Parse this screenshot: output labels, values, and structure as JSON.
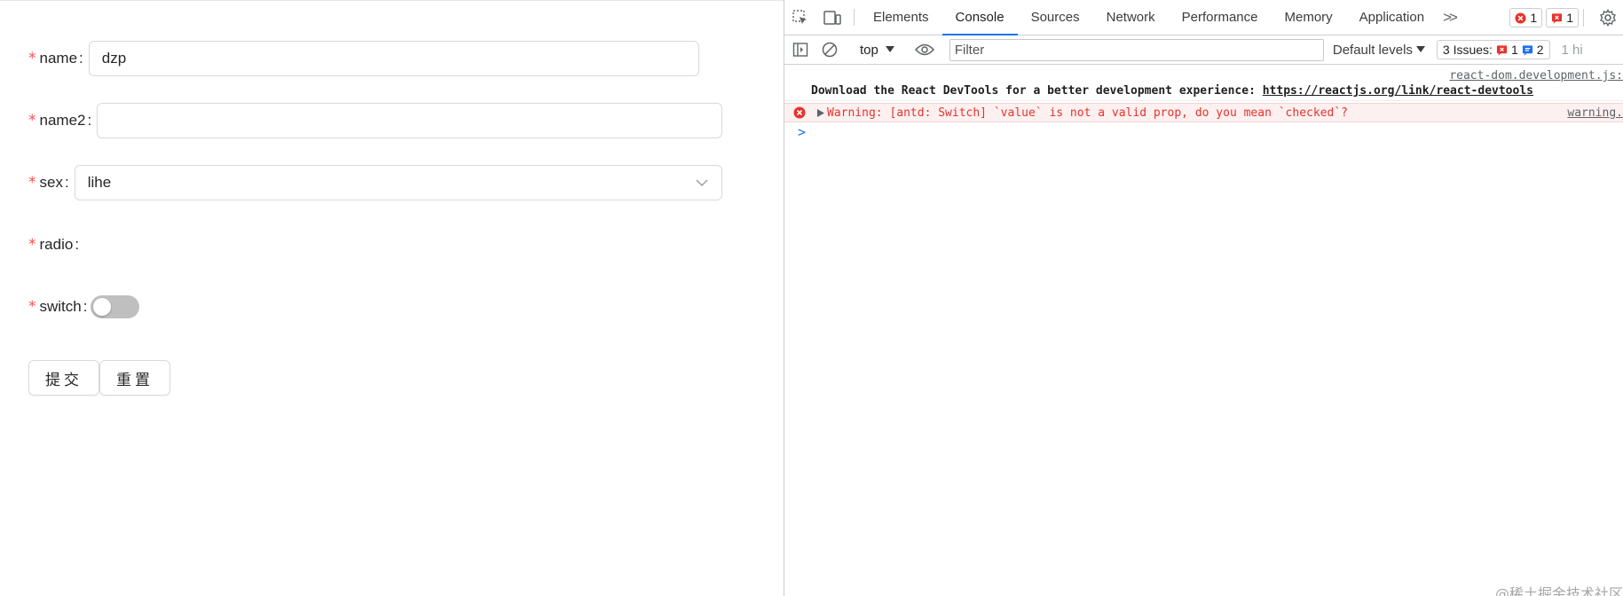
{
  "form": {
    "fields": [
      {
        "label": "name",
        "value": "dzp"
      },
      {
        "label": "name2",
        "value": ""
      },
      {
        "label": "sex",
        "value": "lihe"
      },
      {
        "label": "radio"
      },
      {
        "label": "switch",
        "checked": false
      }
    ],
    "required_mark": "*",
    "colon": ":",
    "buttons": {
      "submit": "提交",
      "reset": "重置"
    }
  },
  "devtools": {
    "tabs": [
      "Elements",
      "Console",
      "Sources",
      "Network",
      "Performance",
      "Memory",
      "Application"
    ],
    "active_tab": "Console",
    "more_tabs": ">>",
    "error_count": "1",
    "issue_badge_count": "1",
    "toolbar": {
      "context": "top",
      "filter_placeholder": "Filter",
      "levels": "Default levels",
      "issues_label": "3 Issues:",
      "issues_errors": "1",
      "issues_info": "2",
      "hidden": "1 hi"
    },
    "messages": [
      {
        "type": "log",
        "source": "react-dom.development.js:",
        "text": "Download the React DevTools for a better development experience: ",
        "link": "https://reactjs.org/link/react-devtools"
      },
      {
        "type": "error",
        "text": "Warning: [antd: Switch] `value` is not a valid prop, do you mean `checked`?",
        "source": "warning."
      }
    ],
    "prompt": ">",
    "watermark": "@稀土掘金技术社区"
  },
  "colors": {
    "required": "#ff4d4f",
    "error_text": "#e8322b",
    "error_bg": "#fdf0f0",
    "tab_underline": "#1a73e8",
    "switch_off": "#bfbfbf"
  }
}
